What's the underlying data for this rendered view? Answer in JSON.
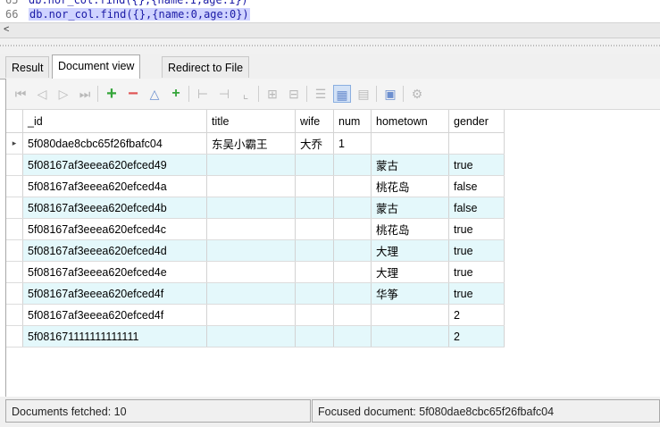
{
  "editor": {
    "line1_number": "65",
    "line1_code": "db.nor_col.find({},{name:1,age:1})",
    "line2_number": "66",
    "line2_code": "db.nor_col.find({},{name:0,age:0})",
    "scroll_left_arrow": "<"
  },
  "tabs": [
    {
      "label": "Result",
      "active": false
    },
    {
      "label": "Document view",
      "active": true
    },
    {
      "label": "Redirect to File",
      "active": false
    }
  ],
  "toolbar": {
    "icons": [
      "first-page-icon",
      "prev-page-icon",
      "next-page-icon",
      "last-page-icon",
      "add-document-icon",
      "remove-document-icon",
      "collapse-icon",
      "add-field-icon",
      "insert-row-icon",
      "remove-row-icon",
      "move-up-icon",
      "grid-icon-1",
      "grid-icon-2",
      "text-view-icon",
      "table-view-icon",
      "form-view-icon",
      "export-icon",
      "settings-icon"
    ]
  },
  "table": {
    "columns": [
      "_id",
      "title",
      "wife",
      "num",
      "hometown",
      "gender"
    ],
    "rows": [
      {
        "_id": "5f080dae8cbc65f26fbafc04",
        "title": "东吴小霸王",
        "wife": "大乔",
        "num": "1",
        "hometown": "",
        "gender": "",
        "current": true
      },
      {
        "_id": "5f08167af3eeea620efced49",
        "title": "",
        "wife": "",
        "num": "",
        "hometown": "蒙古",
        "gender": "true"
      },
      {
        "_id": "5f08167af3eeea620efced4a",
        "title": "",
        "wife": "",
        "num": "",
        "hometown": "桃花岛",
        "gender": "false"
      },
      {
        "_id": "5f08167af3eeea620efced4b",
        "title": "",
        "wife": "",
        "num": "",
        "hometown": "蒙古",
        "gender": "false"
      },
      {
        "_id": "5f08167af3eeea620efced4c",
        "title": "",
        "wife": "",
        "num": "",
        "hometown": "桃花岛",
        "gender": "true"
      },
      {
        "_id": "5f08167af3eeea620efced4d",
        "title": "",
        "wife": "",
        "num": "",
        "hometown": "大理",
        "gender": "true"
      },
      {
        "_id": "5f08167af3eeea620efced4e",
        "title": "",
        "wife": "",
        "num": "",
        "hometown": "大理",
        "gender": "true"
      },
      {
        "_id": "5f08167af3eeea620efced4f",
        "title": "",
        "wife": "",
        "num": "",
        "hometown": "华筝",
        "gender": "true"
      },
      {
        "_id": "5f08167af3eeea620efced4f",
        "title": "",
        "wife": "",
        "num": "",
        "hometown": "",
        "gender": "2"
      },
      {
        "_id": "5f081671111111111111",
        "title": "",
        "wife": "",
        "num": "",
        "hometown": "",
        "gender": "2"
      }
    ]
  },
  "status": {
    "fetched": "Documents fetched: 10",
    "focused": "Focused document: 5f080dae8cbc65f26fbafc04"
  },
  "colors": {
    "alt_row": "#e4f8fb",
    "selection": "#cfd3ff",
    "add_green": "#35a53a",
    "remove_red": "#e05555"
  }
}
